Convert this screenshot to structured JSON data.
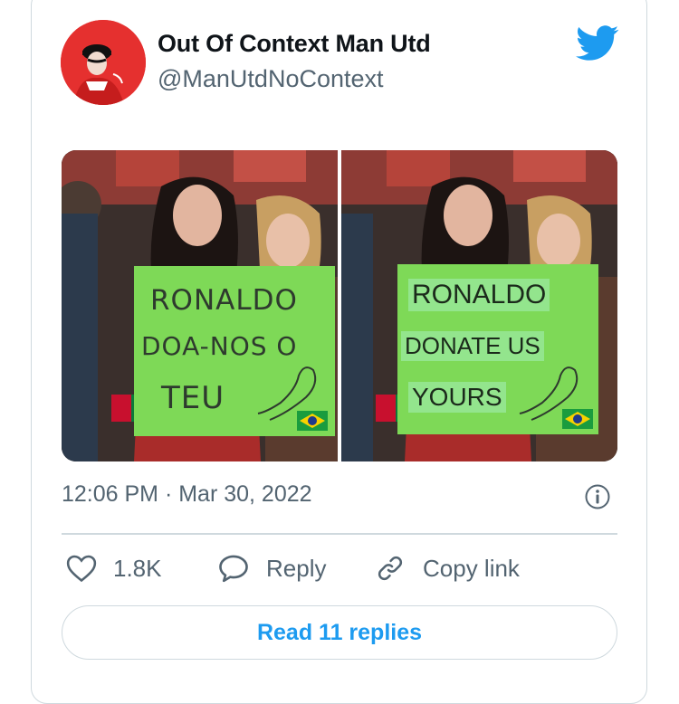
{
  "tweet": {
    "display_name": "Out Of Context Man Utd",
    "handle": "@ManUtdNoContext",
    "timestamp": "12:06 PM · Mar 30, 2022",
    "images": {
      "left_sign": [
        "RONALDO",
        "DOA-NOS O",
        "TEU"
      ],
      "right_sign": [
        "RONALDO",
        "DONATE US",
        "YOURS"
      ]
    }
  },
  "actions": {
    "likes_count": "1.8K",
    "reply_label": "Reply",
    "copy_link_label": "Copy link"
  },
  "read_replies_label": "Read 11 replies",
  "colors": {
    "accent": "#1d9bf0",
    "avatar_bg": "#e5302f",
    "sign_green": "#7ed957",
    "muted": "#536471"
  },
  "icons": {
    "logo": "twitter-bird-icon",
    "info": "info-icon",
    "like": "heart-icon",
    "reply": "speech-bubble-icon",
    "copy": "link-icon"
  }
}
